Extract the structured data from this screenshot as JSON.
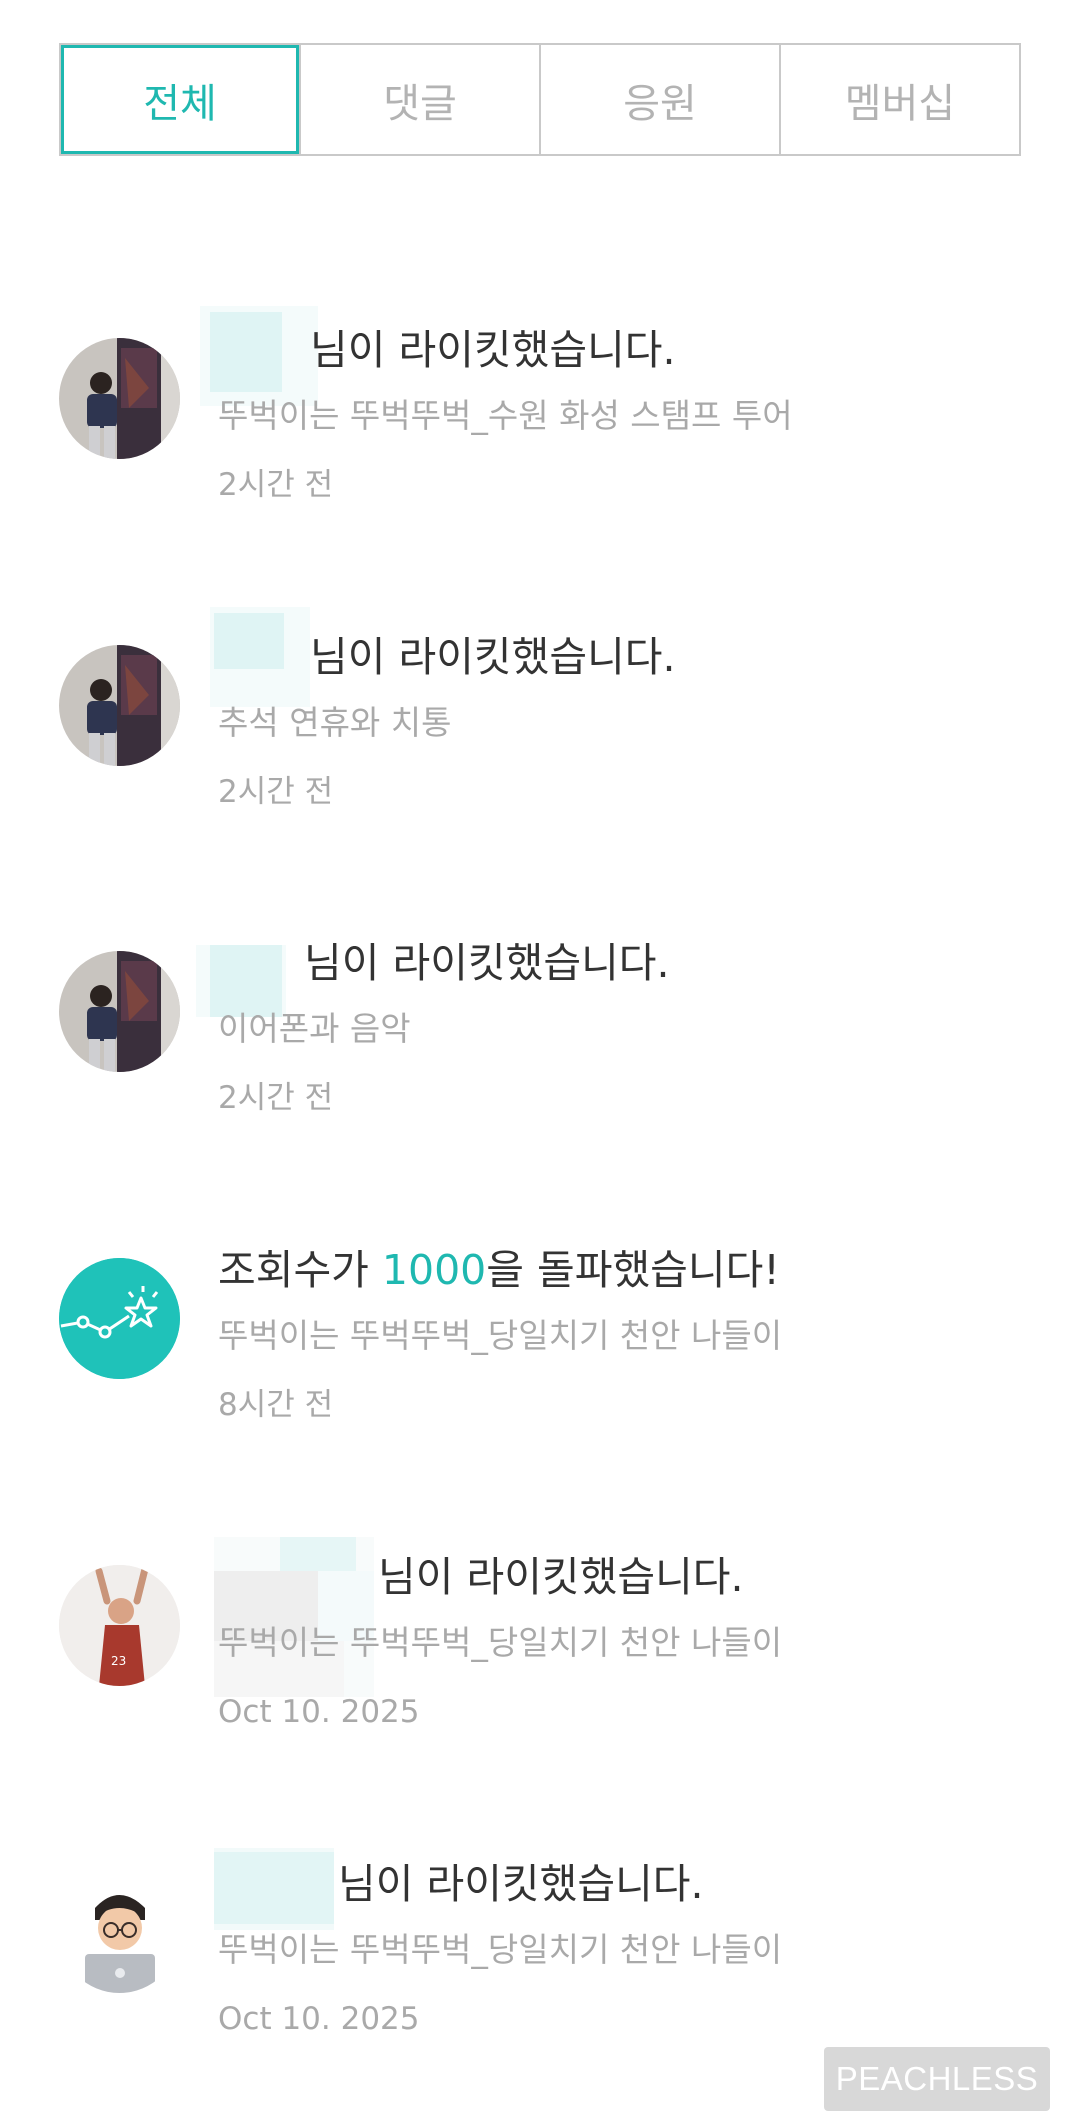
{
  "tabs": [
    {
      "label": "전체",
      "active": true
    },
    {
      "label": "댓글",
      "active": false
    },
    {
      "label": "응원",
      "active": false
    },
    {
      "label": "멤버십",
      "active": false
    }
  ],
  "notifications": [
    {
      "type": "like",
      "title": "님이 라이킷했습니다.",
      "subtitle": "뚜벅이는 뚜벅뚜벅_수원 화성 스탬프 투어",
      "time": "2시간 전",
      "avatar": "speaker-photo"
    },
    {
      "type": "like",
      "title": "님이 라이킷했습니다.",
      "subtitle": "추석 연휴와 치통",
      "time": "2시간 전",
      "avatar": "speaker-photo"
    },
    {
      "type": "like",
      "title": "님이 라이킷했습니다.",
      "subtitle": "이어폰과 음악",
      "time": "2시간 전",
      "avatar": "speaker-photo"
    },
    {
      "type": "milestone",
      "title_prefix": "조회수가 ",
      "title_highlight": "1000",
      "title_suffix": "을 돌파했습니다!",
      "subtitle": "뚜벅이는 뚜벅뚜벅_당일치기 천안 나들이",
      "time": "8시간 전",
      "avatar": "chart-star-icon"
    },
    {
      "type": "like",
      "title": "님이 라이킷했습니다.",
      "subtitle": "뚜벅이는 뚜벅뚜벅_당일치기 천안 나들이",
      "time": "Oct 10. 2025",
      "avatar": "basketball-player-illustration"
    },
    {
      "type": "like",
      "title": "님이 라이킷했습니다.",
      "subtitle": "뚜벅이는 뚜벅뚜벅_당일치기 천안 나들이",
      "time": "Oct 10. 2025",
      "avatar": "laptop-person-emoji"
    }
  ],
  "watermark": "PEACHLESS",
  "colors": {
    "accent": "#1fb8b0",
    "text": "#333333",
    "muted": "#a9a9a9",
    "border": "#c9c9c9"
  }
}
